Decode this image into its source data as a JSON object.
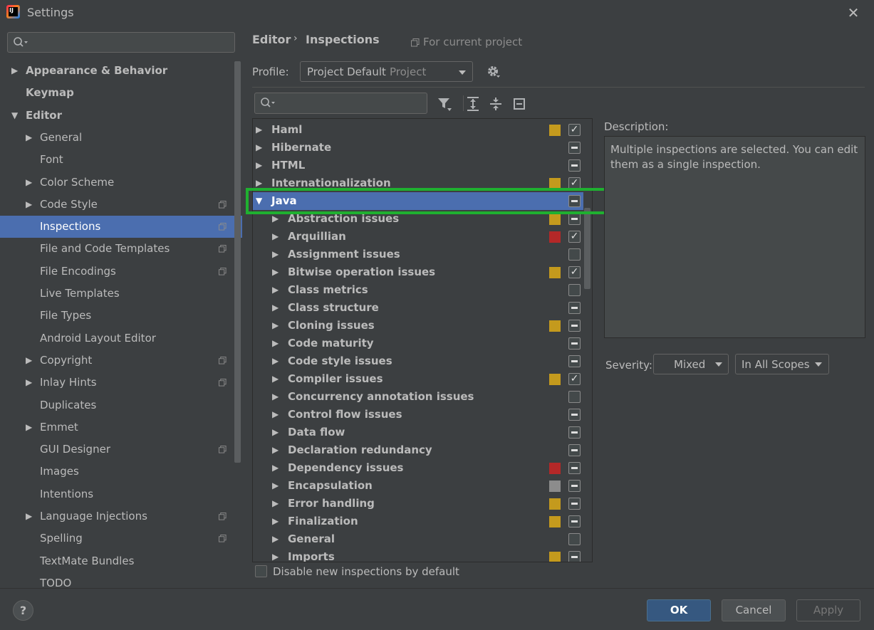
{
  "window": {
    "title": "Settings"
  },
  "sidebar": {
    "items": [
      {
        "label": "Appearance & Behavior",
        "level": 0,
        "arrow": "right",
        "bold": true,
        "icon": false
      },
      {
        "label": "Keymap",
        "level": 0,
        "arrow": "none",
        "bold": true,
        "icon": false
      },
      {
        "label": "Editor",
        "level": 0,
        "arrow": "down",
        "bold": true,
        "icon": false
      },
      {
        "label": "General",
        "level": 1,
        "arrow": "right",
        "bold": false,
        "icon": false
      },
      {
        "label": "Font",
        "level": 1,
        "arrow": "none",
        "bold": false,
        "icon": false
      },
      {
        "label": "Color Scheme",
        "level": 1,
        "arrow": "right",
        "bold": false,
        "icon": false
      },
      {
        "label": "Code Style",
        "level": 1,
        "arrow": "right",
        "bold": false,
        "icon": true
      },
      {
        "label": "Inspections",
        "level": 1,
        "arrow": "none",
        "bold": false,
        "icon": true,
        "selected": true
      },
      {
        "label": "File and Code Templates",
        "level": 1,
        "arrow": "none",
        "bold": false,
        "icon": true
      },
      {
        "label": "File Encodings",
        "level": 1,
        "arrow": "none",
        "bold": false,
        "icon": true
      },
      {
        "label": "Live Templates",
        "level": 1,
        "arrow": "none",
        "bold": false,
        "icon": false
      },
      {
        "label": "File Types",
        "level": 1,
        "arrow": "none",
        "bold": false,
        "icon": false
      },
      {
        "label": "Android Layout Editor",
        "level": 1,
        "arrow": "none",
        "bold": false,
        "icon": false
      },
      {
        "label": "Copyright",
        "level": 1,
        "arrow": "right",
        "bold": false,
        "icon": true
      },
      {
        "label": "Inlay Hints",
        "level": 1,
        "arrow": "right",
        "bold": false,
        "icon": true
      },
      {
        "label": "Duplicates",
        "level": 1,
        "arrow": "none",
        "bold": false,
        "icon": false
      },
      {
        "label": "Emmet",
        "level": 1,
        "arrow": "right",
        "bold": false,
        "icon": false
      },
      {
        "label": "GUI Designer",
        "level": 1,
        "arrow": "none",
        "bold": false,
        "icon": true
      },
      {
        "label": "Images",
        "level": 1,
        "arrow": "none",
        "bold": false,
        "icon": false
      },
      {
        "label": "Intentions",
        "level": 1,
        "arrow": "none",
        "bold": false,
        "icon": false
      },
      {
        "label": "Language Injections",
        "level": 1,
        "arrow": "right",
        "bold": false,
        "icon": true
      },
      {
        "label": "Spelling",
        "level": 1,
        "arrow": "none",
        "bold": false,
        "icon": true
      },
      {
        "label": "TextMate Bundles",
        "level": 1,
        "arrow": "none",
        "bold": false,
        "icon": false
      },
      {
        "label": "TODO",
        "level": 1,
        "arrow": "none",
        "bold": false,
        "icon": false
      }
    ]
  },
  "header": {
    "crumb_editor": "Editor",
    "crumb_sep": "›",
    "crumb_inspections": "Inspections",
    "for_project": "For current project",
    "profile_label": "Profile:",
    "profile_value": "Project Default",
    "profile_sub": "Project"
  },
  "tree": {
    "rows": [
      {
        "label": "Haml",
        "level": 0,
        "arrow": "right",
        "severity": "#c49a1d",
        "check": "checked"
      },
      {
        "label": "Hibernate",
        "level": 0,
        "arrow": "right",
        "severity": null,
        "check": "dash"
      },
      {
        "label": "HTML",
        "level": 0,
        "arrow": "right",
        "severity": null,
        "check": "dash"
      },
      {
        "label": "Internationalization",
        "level": 0,
        "arrow": "right",
        "severity": "#c49a1d",
        "check": "checked"
      },
      {
        "label": "Java",
        "level": 0,
        "arrow": "down",
        "severity": null,
        "check": "dash",
        "selected": true
      },
      {
        "label": "Abstraction issues",
        "level": 1,
        "arrow": "right",
        "severity": "#c49a1d",
        "check": "dash"
      },
      {
        "label": "Arquillian",
        "level": 1,
        "arrow": "right",
        "severity": "#b42828",
        "check": "checked"
      },
      {
        "label": "Assignment issues",
        "level": 1,
        "arrow": "right",
        "severity": null,
        "check": "empty"
      },
      {
        "label": "Bitwise operation issues",
        "level": 1,
        "arrow": "right",
        "severity": "#c49a1d",
        "check": "checked"
      },
      {
        "label": "Class metrics",
        "level": 1,
        "arrow": "right",
        "severity": null,
        "check": "empty"
      },
      {
        "label": "Class structure",
        "level": 1,
        "arrow": "right",
        "severity": null,
        "check": "dash"
      },
      {
        "label": "Cloning issues",
        "level": 1,
        "arrow": "right",
        "severity": "#c49a1d",
        "check": "dash"
      },
      {
        "label": "Code maturity",
        "level": 1,
        "arrow": "right",
        "severity": null,
        "check": "dash"
      },
      {
        "label": "Code style issues",
        "level": 1,
        "arrow": "right",
        "severity": null,
        "check": "dash"
      },
      {
        "label": "Compiler issues",
        "level": 1,
        "arrow": "right",
        "severity": "#c49a1d",
        "check": "checked"
      },
      {
        "label": "Concurrency annotation issues",
        "level": 1,
        "arrow": "right",
        "severity": null,
        "check": "empty"
      },
      {
        "label": "Control flow issues",
        "level": 1,
        "arrow": "right",
        "severity": null,
        "check": "dash"
      },
      {
        "label": "Data flow",
        "level": 1,
        "arrow": "right",
        "severity": null,
        "check": "dash"
      },
      {
        "label": "Declaration redundancy",
        "level": 1,
        "arrow": "right",
        "severity": null,
        "check": "dash"
      },
      {
        "label": "Dependency issues",
        "level": 1,
        "arrow": "right",
        "severity": "#b42828",
        "check": "dash"
      },
      {
        "label": "Encapsulation",
        "level": 1,
        "arrow": "right",
        "severity": "#8c8c8c",
        "check": "dash"
      },
      {
        "label": "Error handling",
        "level": 1,
        "arrow": "right",
        "severity": "#c49a1d",
        "check": "dash"
      },
      {
        "label": "Finalization",
        "level": 1,
        "arrow": "right",
        "severity": "#c49a1d",
        "check": "dash"
      },
      {
        "label": "General",
        "level": 1,
        "arrow": "right",
        "severity": null,
        "check": "empty"
      },
      {
        "label": "Imports",
        "level": 1,
        "arrow": "right",
        "severity": "#c49a1d",
        "check": "dash"
      }
    ]
  },
  "description": {
    "label": "Description:",
    "text": "Multiple inspections are selected. You can edit them as a single inspection.",
    "severity_label": "Severity:",
    "severity_value": "Mixed",
    "scope_value": "In All Scopes"
  },
  "options": {
    "disable_new_label": "Disable new inspections by default"
  },
  "footer": {
    "help": "?",
    "ok": "OK",
    "cancel": "Cancel",
    "apply": "Apply"
  },
  "colors": {
    "selection": "#4b6eaf",
    "highlight_box": "#1fb030",
    "ok_button": "#365880"
  }
}
